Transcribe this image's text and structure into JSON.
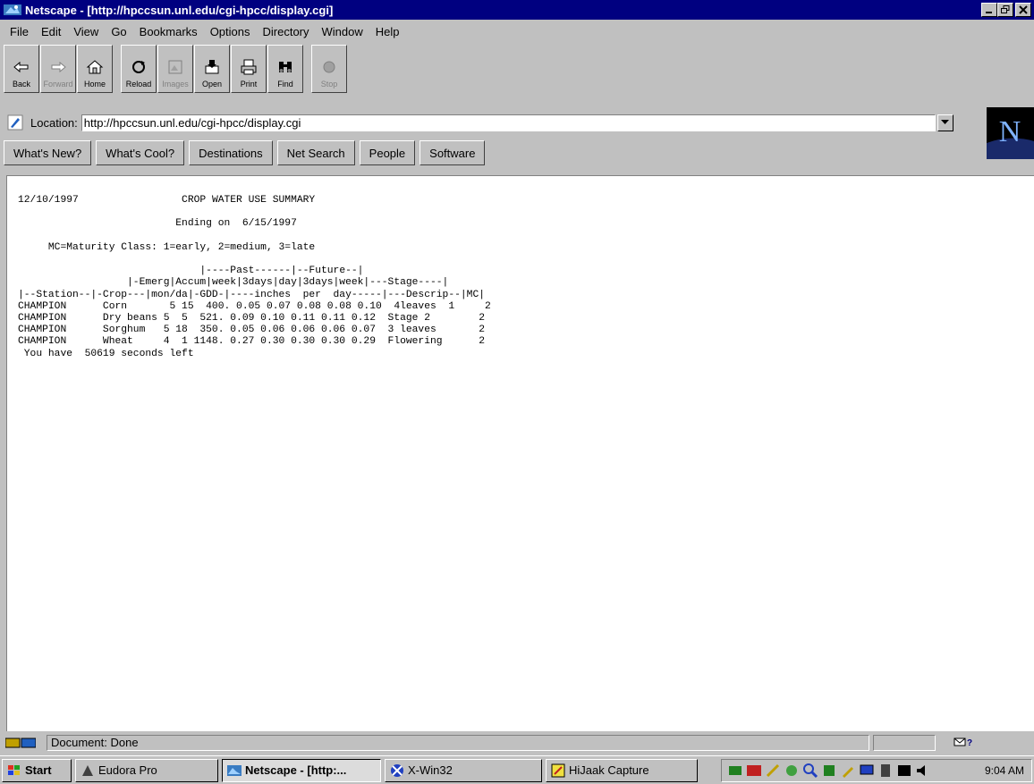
{
  "window": {
    "title": "Netscape - [http://hpccsun.unl.edu/cgi-hpcc/display.cgi]",
    "minimize_label": "_",
    "maximize_label": "▫",
    "close_label": "×"
  },
  "menu": {
    "items": [
      {
        "label": "File"
      },
      {
        "label": "Edit"
      },
      {
        "label": "View"
      },
      {
        "label": "Go"
      },
      {
        "label": "Bookmarks"
      },
      {
        "label": "Options"
      },
      {
        "label": "Directory"
      },
      {
        "label": "Window"
      },
      {
        "label": "Help"
      }
    ]
  },
  "toolbar": {
    "back": "Back",
    "forward": "Forward",
    "home": "Home",
    "reload": "Reload",
    "images": "Images",
    "open": "Open",
    "print": "Print",
    "find": "Find",
    "stop": "Stop"
  },
  "location": {
    "label": "Location:",
    "value": "http://hpccsun.unl.edu/cgi-hpcc/display.cgi"
  },
  "directory_buttons": {
    "whats_new": "What's New?",
    "whats_cool": "What's Cool?",
    "destinations": "Destinations",
    "net_search": "Net Search",
    "people": "People",
    "software": "Software"
  },
  "page": {
    "date": "12/10/1997",
    "title": "CROP WATER USE SUMMARY",
    "ending": "Ending on  6/15/1997",
    "legend": "MC=Maturity Class: 1=early, 2=medium, 3=late",
    "header_line1": "|----Past------|--Future--|",
    "header_line2": "|-Emerg|Accum|week|3days|day|3days|week|---Stage----|",
    "header_line3": "|--Station--|-Crop---|mon/da|-GDD-|----inches  per  day-----|---Descrip--|MC|",
    "rows": [
      "CHAMPION      Corn       5 15  400. 0.05 0.07 0.08 0.08 0.10  4leaves  1     2",
      "CHAMPION      Dry beans 5  5  521. 0.09 0.10 0.11 0.11 0.12  Stage 2        2",
      "CHAMPION      Sorghum   5 18  350. 0.05 0.06 0.06 0.06 0.07  3 leaves       2",
      "CHAMPION      Wheat     4  1 1148. 0.27 0.30 0.30 0.30 0.29  Flowering      2"
    ],
    "footer": " You have  50619 seconds left"
  },
  "status": {
    "text": "Document: Done"
  },
  "taskbar": {
    "start": "Start",
    "tasks": [
      {
        "label": "Eudora Pro"
      },
      {
        "label": "Netscape - [http:..."
      },
      {
        "label": "X-Win32"
      },
      {
        "label": "HiJaak Capture"
      }
    ],
    "clock": "9:04 AM"
  },
  "colors": {
    "titlebar": "#000080",
    "chrome": "#c0c0c0",
    "content_bg": "#ffffff"
  }
}
